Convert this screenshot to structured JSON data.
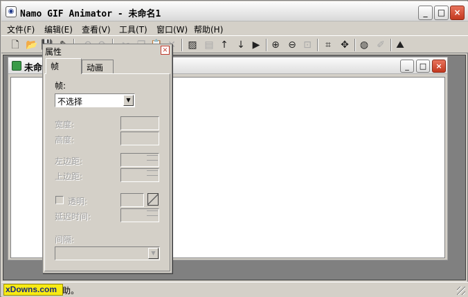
{
  "window": {
    "title": "Namo GIF Animator - 未命名1",
    "minimize": "_",
    "maximize": "□",
    "close": "×"
  },
  "menu": [
    {
      "label": "文件(F)"
    },
    {
      "label": "编辑(E)"
    },
    {
      "label": "查看(V)"
    },
    {
      "label": "工具(T)"
    },
    {
      "label": "窗口(W)"
    },
    {
      "label": "帮助(H)"
    }
  ],
  "toolbar": [
    {
      "icon": "new-file-icon",
      "glyph": "🗋",
      "enabled": true
    },
    {
      "icon": "open-folder-icon",
      "glyph": "📂",
      "enabled": true
    },
    {
      "icon": "save-icon",
      "glyph": "💾",
      "enabled": true
    },
    {
      "icon": "wizard-icon",
      "glyph": "✎",
      "enabled": true
    },
    {
      "icon": "undo-icon",
      "glyph": "↶",
      "enabled": false
    },
    {
      "icon": "redo-icon",
      "glyph": "↷",
      "enabled": false
    },
    {
      "icon": "cut-icon",
      "glyph": "✂",
      "enabled": false
    },
    {
      "icon": "copy-icon",
      "glyph": "❐",
      "enabled": false
    },
    {
      "icon": "paste-icon",
      "glyph": "📋",
      "enabled": true
    },
    {
      "icon": "delete-icon",
      "glyph": "✕",
      "enabled": false
    },
    {
      "icon": "insert-image-icon",
      "glyph": "▨",
      "enabled": true
    },
    {
      "icon": "insert-frame-icon",
      "glyph": "▤",
      "enabled": false
    },
    {
      "icon": "move-up-icon",
      "glyph": "↑",
      "enabled": true
    },
    {
      "icon": "move-down-icon",
      "glyph": "↓",
      "enabled": true
    },
    {
      "icon": "play-icon",
      "glyph": "▶",
      "enabled": true
    },
    {
      "icon": "zoom-in-icon",
      "glyph": "⊕",
      "enabled": true
    },
    {
      "icon": "zoom-out-icon",
      "glyph": "⊖",
      "enabled": true
    },
    {
      "icon": "zoom-fit-icon",
      "glyph": "⊡",
      "enabled": false
    },
    {
      "icon": "crop-icon",
      "glyph": "⌗",
      "enabled": true
    },
    {
      "icon": "move-icon",
      "glyph": "✥",
      "enabled": true
    },
    {
      "icon": "palette-icon",
      "glyph": "◍",
      "enabled": true
    },
    {
      "icon": "edit-image-icon",
      "glyph": "✐",
      "enabled": false
    },
    {
      "icon": "landscape-icon",
      "glyph": "⛰",
      "enabled": true
    }
  ],
  "document": {
    "title": "未命",
    "minimize": "_",
    "maximize": "□",
    "close": "×"
  },
  "properties": {
    "title": "属性",
    "close": "×",
    "tabs": [
      {
        "label": "帧",
        "active": true
      },
      {
        "label": "动画",
        "active": false
      }
    ],
    "frame_label": "帧:",
    "frame_select": "不选择",
    "width_label": "宽度:",
    "height_label": "高度:",
    "left_label": "左边距:",
    "top_label": "上边距:",
    "transparent_label": "透明:",
    "delay_label": "延迟时间:",
    "interval_label": "间隔:"
  },
  "status": {
    "text": "助。",
    "watermark": "xDowns.com"
  }
}
